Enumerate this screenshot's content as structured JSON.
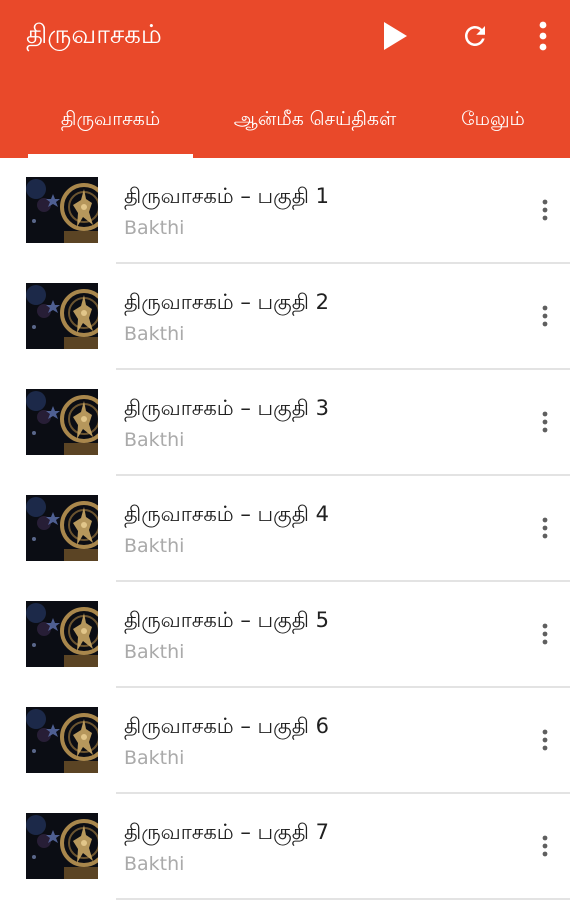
{
  "app": {
    "title": "திருவாசகம்"
  },
  "toolbar": {
    "icons": [
      "play-icon",
      "refresh-icon",
      "more-vert-icon"
    ]
  },
  "tabs": [
    {
      "label": "திருவாசகம்",
      "selected": true
    },
    {
      "label": "ஆன்மீக செய்திகள்",
      "selected": false
    },
    {
      "label": "மேலும்",
      "selected": false
    }
  ],
  "tracks": [
    {
      "title": "திருவாசகம் – பகுதி 1",
      "subtitle": "Bakthi"
    },
    {
      "title": "திருவாசகம் – பகுதி 2",
      "subtitle": "Bakthi"
    },
    {
      "title": "திருவாசகம் – பகுதி 3",
      "subtitle": "Bakthi"
    },
    {
      "title": "திருவாசகம் – பகுதி 4",
      "subtitle": "Bakthi"
    },
    {
      "title": "திருவாசகம் – பகுதி 5",
      "subtitle": "Bakthi"
    },
    {
      "title": "திருவாசகம் – பகுதி 6",
      "subtitle": "Bakthi"
    },
    {
      "title": "திருவாசகம் – பகுதி 7",
      "subtitle": "Bakthi"
    }
  ],
  "colors": {
    "accent": "#e9492a",
    "title_text": "#202020",
    "subtitle_text": "#aaaaaa"
  }
}
